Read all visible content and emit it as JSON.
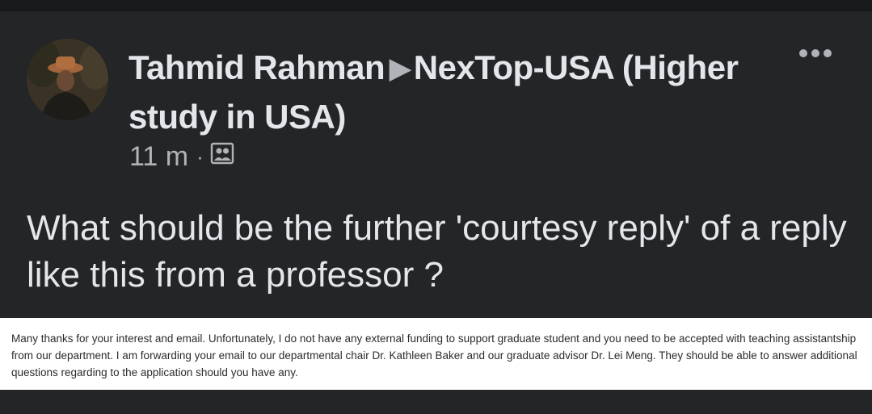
{
  "post": {
    "author": "Tahmid Rahman",
    "group": "NexTop-USA (Higher study in USA)",
    "arrow": "▶",
    "time": "11 m",
    "separator": "·",
    "question": "What should be the further 'courtesy reply' of a reply like this from a professor ?",
    "attached_text": "Many thanks for your interest and email. Unfortunately, I do not have any external funding to support graduate student and you need to be accepted with teaching assistantship from our department. I am forwarding your email to our departmental chair Dr. Kathleen Baker and our graduate advisor Dr. Lei Meng. They should be able to answer additional questions regarding to the application should you have any."
  },
  "icons": {
    "more": "more-options-icon",
    "audience": "audience-group-icon"
  },
  "colors": {
    "background": "#18191a",
    "card": "#242526",
    "primary_text": "#e4e6eb",
    "secondary_text": "#b0b3b8"
  }
}
